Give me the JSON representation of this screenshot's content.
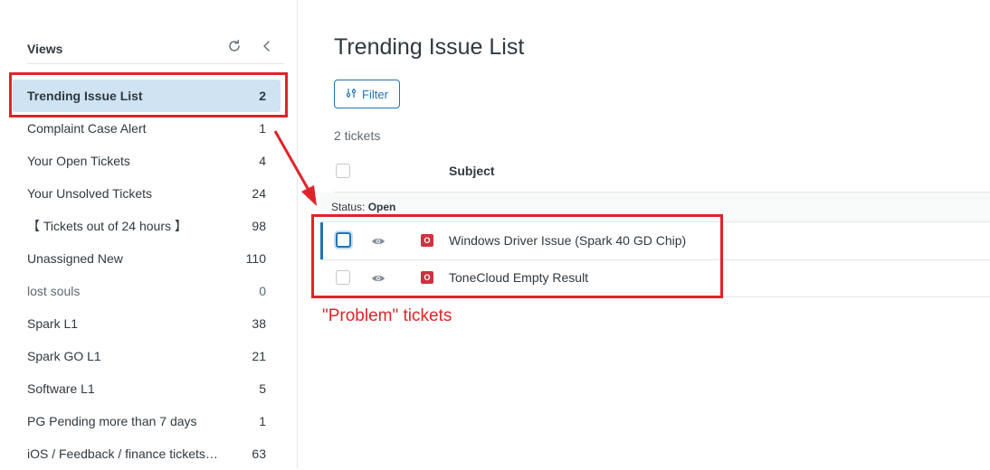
{
  "sidebar": {
    "title": "Views",
    "refresh_icon": "refresh-icon",
    "collapse_icon": "chevron-left-icon",
    "items": [
      {
        "label": "Trending Issue List",
        "count": "2"
      },
      {
        "label": "Complaint Case Alert",
        "count": "1"
      },
      {
        "label": "Your Open Tickets",
        "count": "4"
      },
      {
        "label": "Your Unsolved Tickets",
        "count": "24"
      },
      {
        "label": "【 Tickets out of 24 hours 】",
        "count": "98"
      },
      {
        "label": "Unassigned New",
        "count": "110"
      },
      {
        "label": "lost souls",
        "count": "0"
      },
      {
        "label": "Spark L1",
        "count": "38"
      },
      {
        "label": "Spark GO L1",
        "count": "21"
      },
      {
        "label": "Software L1",
        "count": "5"
      },
      {
        "label": "PG Pending more than 7 days",
        "count": "1"
      },
      {
        "label": "iOS / Feedback / finance tickets ...",
        "count": "63"
      }
    ]
  },
  "main": {
    "title": "Trending Issue List",
    "filter_label": "Filter",
    "ticket_count": "2 tickets",
    "columns": {
      "subject": "Subject"
    },
    "group": {
      "label": "Status:",
      "value": "Open"
    },
    "tickets": [
      {
        "status_letter": "O",
        "subject": "Windows Driver Issue (Spark 40 GD Chip)"
      },
      {
        "status_letter": "O",
        "subject": "ToneCloud Empty Result"
      }
    ]
  },
  "annotation": {
    "label": "\"Problem\" tickets",
    "color": "#e0232a"
  },
  "colors": {
    "accent": "#1f73b7",
    "active_bg": "#cfe3f3",
    "status_open": "#cc3340"
  }
}
